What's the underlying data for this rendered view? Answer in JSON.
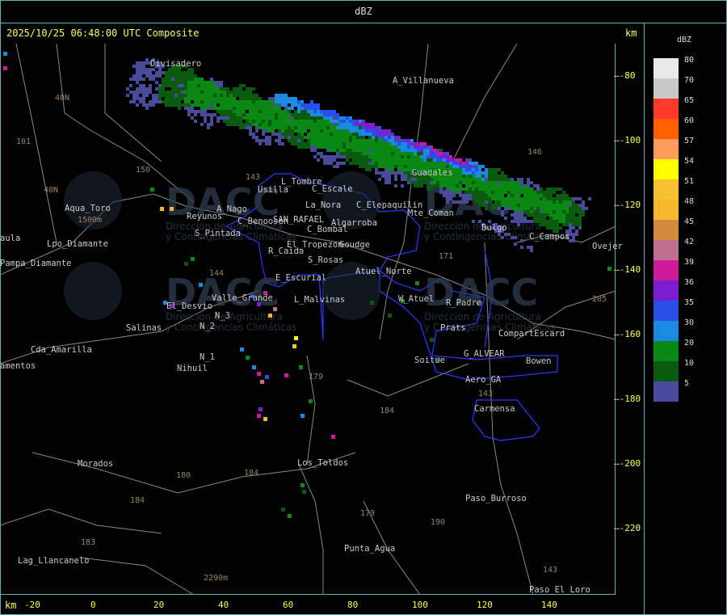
{
  "window": {
    "title": "dBZ"
  },
  "header": {
    "timestamp": "2025/10/25 06:48:00 UTC Composite",
    "unit_top": "km",
    "unit_bottom": "km"
  },
  "legend": {
    "title": "dBZ",
    "items": [
      {
        "label": "80",
        "color": "#e8e8e8"
      },
      {
        "label": "70",
        "color": "#c8c8c8"
      },
      {
        "label": "65",
        "color": "#ff3a2a"
      },
      {
        "label": "60",
        "color": "#ff6000"
      },
      {
        "label": "57",
        "color": "#ff9a5a"
      },
      {
        "label": "54",
        "color": "#ffff00"
      },
      {
        "label": "51",
        "color": "#f6c030"
      },
      {
        "label": "48",
        "color": "#f5b82f"
      },
      {
        "label": "45",
        "color": "#d48a3c"
      },
      {
        "label": "42",
        "color": "#c06e8e"
      },
      {
        "label": "39",
        "color": "#cc1a9a"
      },
      {
        "label": "36",
        "color": "#7a1ecf"
      },
      {
        "label": "35",
        "color": "#2a4ee8"
      },
      {
        "label": "30",
        "color": "#1a8ae0"
      },
      {
        "label": "20",
        "color": "#0a8a14"
      },
      {
        "label": "10",
        "color": "#0a5a10"
      },
      {
        "label": "5",
        "color": "#4a4a9a"
      }
    ]
  },
  "axes": {
    "y_ticks": [
      "-80",
      "-100",
      "-120",
      "-140",
      "-160",
      "-180",
      "-200",
      "-220"
    ],
    "x_ticks": [
      "-20",
      "0",
      "20",
      "40",
      "60",
      "80",
      "100",
      "120",
      "140"
    ]
  },
  "places": [
    "Divisadero",
    "A_Villanueva",
    "Usilla",
    "L_Tombre",
    "C_Escale",
    "La_Nora",
    "C_Elepaquilin",
    "Aqua_Toro",
    "Reyunos",
    "A_Nago",
    "C_Benoosen",
    "SAN_RAFAEL",
    "Algarroba",
    "C_Bombal",
    "S_Pintada",
    "Lpo_Diamante",
    "Pampa_Diamante",
    "El_Tropezon",
    "Goudge",
    "R_Caida",
    "S_Rosas",
    "E_Escurial",
    "Atuel_Norte",
    "Valle_Grande",
    "L_Malvinas",
    "El_Desvio",
    "Salinas",
    "N_3",
    "N_2",
    "Cda_Amarilla",
    "N_1",
    "Nihuil",
    "W_Atuel",
    "R_Padre",
    "Prats",
    "CompartEscard",
    "G_ALVEAR",
    "Soitue",
    "Bowen",
    "Aero_GA",
    "Carmensa",
    "Los_Toldos",
    "Morados",
    "Paso_Burroso",
    "Punta_Agua",
    "Lag_Llancanelo",
    "Paso_El_Loro",
    "Guadales",
    "Mte_Coman",
    "C_Campos",
    "Ovejer",
    "Bulgo",
    "amentos",
    "aula"
  ],
  "routes": [
    "40N",
    "101",
    "40N",
    "150",
    "143",
    "146",
    "171",
    "144",
    "179",
    "184",
    "180",
    "184",
    "184",
    "183",
    "179",
    "190",
    "143",
    "143",
    "205",
    "2290m",
    "1500m"
  ],
  "watermarks": {
    "logo": "DACC",
    "line1": "Dirección de Agricultura",
    "line2": "y Contingencias Climáticas"
  }
}
